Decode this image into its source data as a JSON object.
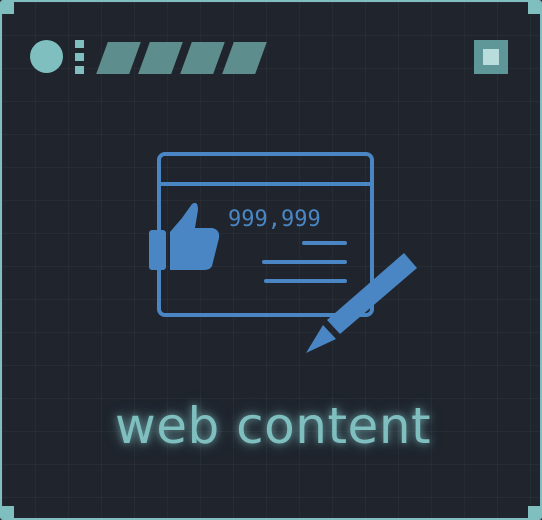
{
  "colors": {
    "background": "#1f242d",
    "accent": "#7fbfc0",
    "stripe": "#5e8d8e",
    "illustration": "#4a86c4"
  },
  "icons": {
    "window": "browser-window-icon",
    "like": "thumbs-up-icon",
    "pen": "pen-icon"
  },
  "illustration": {
    "counter": "999,999"
  },
  "caption": "web content"
}
